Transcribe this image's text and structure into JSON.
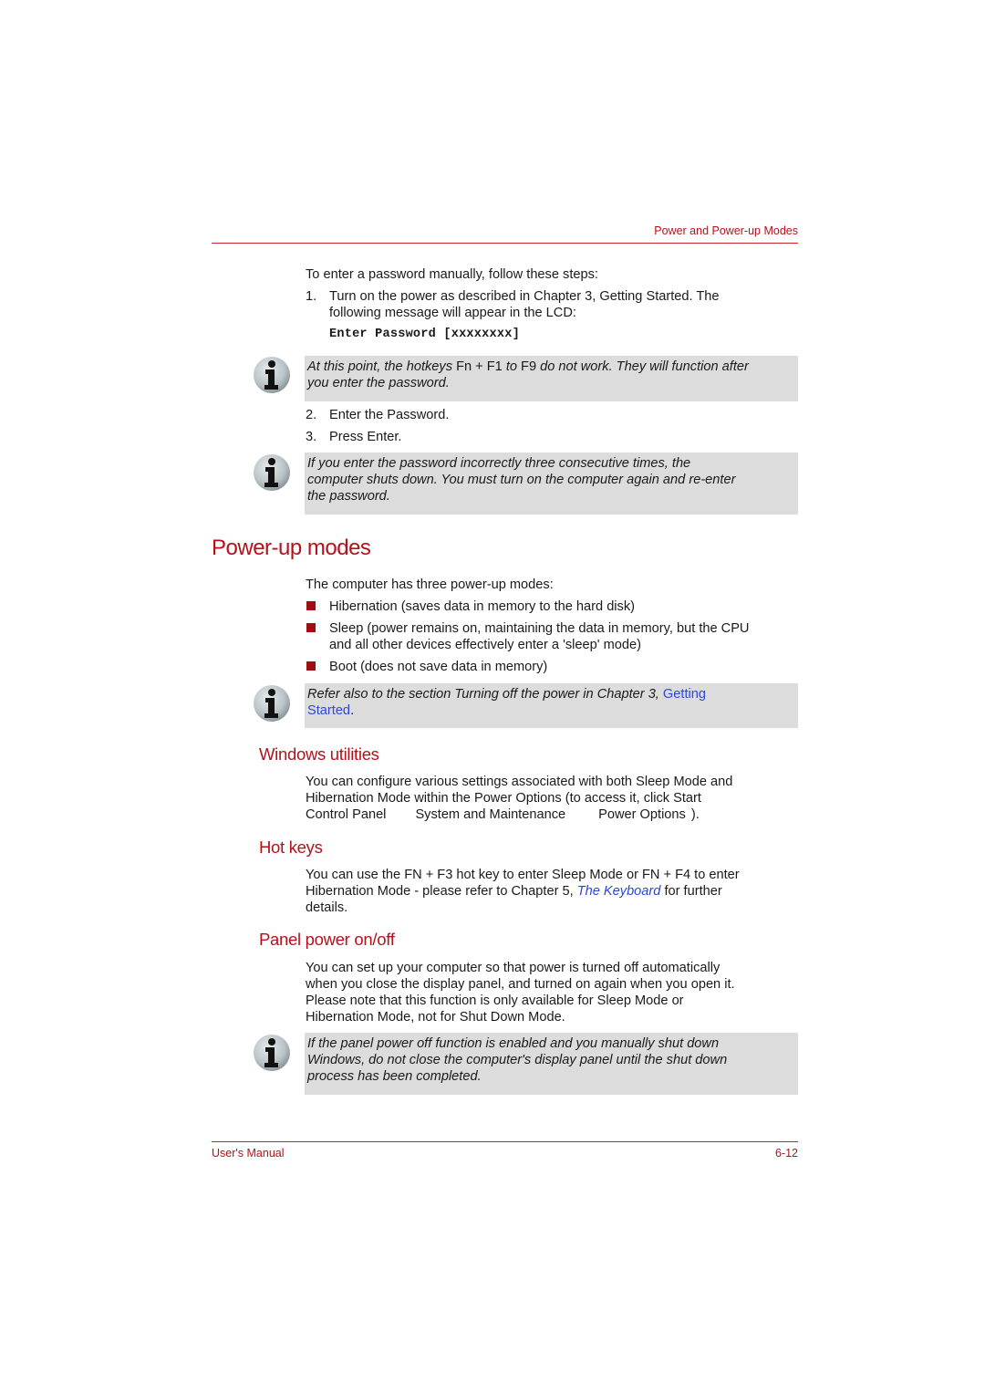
{
  "header": {
    "chapter_title": "Power and Power-up Modes"
  },
  "footer": {
    "left": "User's Manual",
    "page_number": "6-12"
  },
  "password_steps": {
    "intro": "To enter a password manually, follow these steps:",
    "step1_number": "1.",
    "step1_line1": "Turn on the power as described in Chapter 3, Getting Started. The",
    "step1_line2": "following message will appear in the LCD:",
    "lcd_message": "Enter Password [xxxxxxxx]",
    "note1": {
      "line1_a": "At this point, the hotkeys ",
      "line1_b": "Fn + F1",
      "line1_c": " to ",
      "line1_d": "F9",
      "line1_e": " do not work. They will function after",
      "line2": "you enter the password."
    },
    "step2_number": "2.",
    "step2_text": "Enter the Password.",
    "step3_number": "3.",
    "step3_text": "Press Enter.",
    "note2": {
      "line1": "If you enter the password incorrectly three consecutive times, the",
      "line2": "computer shuts down. You must turn on the computer again and re-enter",
      "line3": "the password."
    }
  },
  "power_up_modes": {
    "heading": "Power-up modes",
    "intro": "The computer has three power-up modes:",
    "bullets": [
      {
        "line1": "Hibernation (saves data in memory to the hard disk)"
      },
      {
        "line1": "Sleep (power remains on, maintaining the data in memory, but the CPU",
        "line2": "and all other devices effectively enter a 'sleep' mode)"
      },
      {
        "line1": "Boot (does not save data in memory)"
      }
    ],
    "note": {
      "line1_text": "Refer also to the section Turning off the power in Chapter 3, ",
      "line1_link": "Getting",
      "line2_link": "Started",
      "line2_tail": "."
    }
  },
  "windows_utilities": {
    "heading": "Windows utilities",
    "line1": "You can configure various settings associated with both Sleep Mode and",
    "line2": "Hibernation Mode within the Power Options (to access it, click Start",
    "path_1": "Control Panel",
    "path_2": "System and Maintenance",
    "path_3": "Power Options",
    "path_end": ").",
    "colors": {
      "heading": "#b3121b"
    }
  },
  "hot_keys": {
    "heading": "Hot keys",
    "line1": "You can use the FN + F3 hot key to enter Sleep Mode or FN + F4 to enter",
    "line2_a": "Hibernation Mode - please refer to Chapter 5, ",
    "line2_link": "The Keyboard",
    "line2_b": " for further",
    "line3": "details."
  },
  "panel_power": {
    "heading": "Panel power on/off",
    "line1": "You can set up your computer so that power is turned off automatically",
    "line2": "when you close the display panel, and turned on again when you open it.",
    "line3": "Please note that this function is only available for Sleep Mode or",
    "line4": "Hibernation Mode, not for Shut Down Mode.",
    "note": {
      "line1": "If the panel power off function is enabled and you manually shut down",
      "line2": "Windows, do not close the computer's display panel until the shut down",
      "line3": "process has been completed."
    }
  },
  "icons": {
    "info": "info-icon",
    "bullet": "square-bullet-icon"
  },
  "colors": {
    "accent": "#b3121b",
    "link": "#2c48d6",
    "note_background": "#dcdcdc",
    "bullet": "#a10d12"
  }
}
